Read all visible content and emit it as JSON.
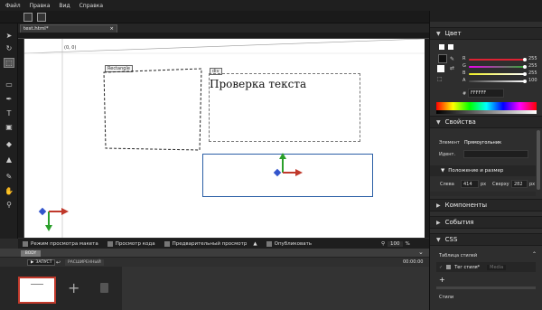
{
  "menu": [
    "Файл",
    "Правка",
    "Вид",
    "Справка"
  ],
  "document": {
    "tab_title": "test.html*",
    "close": "×"
  },
  "canvas": {
    "origin_label": "(0, 0)",
    "rect_label": "Rectangle",
    "div_label": "div",
    "text": "Проверка текста"
  },
  "bottom_bar": {
    "layout_view": "Режим просмотра макета",
    "code_view": "Просмотр кода",
    "preview": "Предварительный просмотр",
    "publish": "Опубликовать",
    "zoom": "100",
    "zoom_unit": "%"
  },
  "timeline": {
    "body_tag": "BODY",
    "play": "ЗАПУСТ",
    "advanced": "РАСШИРЕННЫЙ",
    "time": "00:00:00",
    "time2": "00:00:00",
    "add": "+"
  },
  "color_panel": {
    "title": "Цвет",
    "r_label": "R",
    "g_label": "G",
    "b_label": "B",
    "a_label": "A",
    "r_val": "255",
    "g_val": "255",
    "b_val": "255",
    "a_val": "100",
    "hash": "#",
    "hex": "FFFFFF",
    "r_level": 1.0,
    "g_level": 1.0,
    "b_level": 1.0,
    "a_level": 1.0
  },
  "properties": {
    "title": "Свойства",
    "element_label": "Элемент",
    "element_value": "Прямоугольник",
    "id_label": "Идент.",
    "pos_size": "Положение и размер",
    "left_label": "Слева",
    "left_value": "414",
    "left_unit": "px",
    "top_label": "Сверху",
    "top_value": "282",
    "top_unit": "px"
  },
  "sections": {
    "components": "Компоненты",
    "events": "События",
    "css": "CSS",
    "style_table": "Таблица стилей",
    "tag_style": "Тег стиля*",
    "media": "Media",
    "add": "+",
    "styles": "Стили"
  }
}
